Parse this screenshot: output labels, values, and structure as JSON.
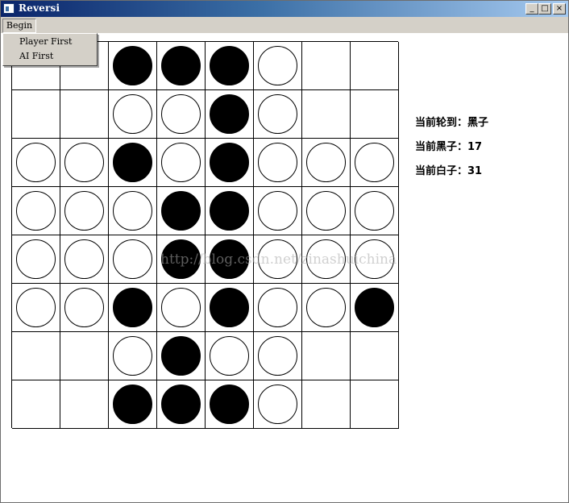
{
  "window": {
    "title": "Reversi",
    "min_glyph": "_",
    "max_glyph": "□",
    "close_glyph": "×"
  },
  "menu": {
    "begin_label": "Begin",
    "items": [
      "Player First",
      "AI First"
    ]
  },
  "board": {
    "rows": [
      [
        null,
        null,
        "black",
        "black",
        "black",
        "white",
        null,
        null
      ],
      [
        null,
        null,
        "white",
        "white",
        "black",
        "white",
        null,
        null
      ],
      [
        "white",
        "white",
        "black",
        "white",
        "black",
        "white",
        "white",
        "white"
      ],
      [
        "white",
        "white",
        "white",
        "black",
        "black",
        "white",
        "white",
        "white"
      ],
      [
        "white",
        "white",
        "white",
        "black",
        "black",
        "white",
        "white",
        "white"
      ],
      [
        "white",
        "white",
        "black",
        "white",
        "black",
        "white",
        "white",
        "black"
      ],
      [
        null,
        null,
        "white",
        "black",
        "white",
        "white",
        null,
        null
      ],
      [
        null,
        null,
        "black",
        "black",
        "black",
        "white",
        null,
        null
      ]
    ]
  },
  "watermark": "http://blog.csdn.net/zinashuichina",
  "status": {
    "turn": "当前轮到：黑子",
    "black_count": "当前黑子：17",
    "white_count": "当前白子：31"
  },
  "colors": {
    "title_gradient_start": "#0a246a",
    "title_gradient_end": "#a6caf0",
    "chrome": "#d4d0c8",
    "black_piece": "#000000",
    "white_piece": "#ffffff"
  }
}
